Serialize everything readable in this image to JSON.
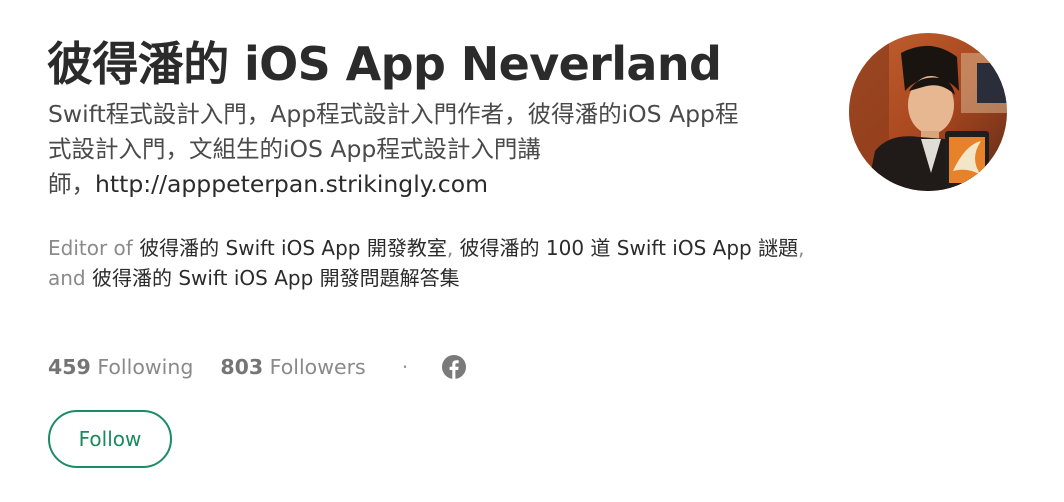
{
  "profile": {
    "name": "彼得潘的 iOS App Neverland",
    "bio_line1": "Swift程式設計入門，App程式設計入門作者，彼得潘的iOS App程",
    "bio_line2": "式設計入門，文組生的iOS App程式設計入門講",
    "bio_line3_prefix": "師，",
    "bio_url": "http://apppeterpan.strikingly.com"
  },
  "editor": {
    "prefix": "Editor of ",
    "publications": [
      "彼得潘的 Swift iOS App 開發教室",
      "彼得潘的 100 道 Swift iOS App 謎題",
      "彼得潘的 Swift iOS App 開發問題解答集"
    ],
    "separator": ", ",
    "and_word": "and "
  },
  "stats": {
    "following_count": "459",
    "following_label": "Following",
    "followers_count": "803",
    "followers_label": "Followers",
    "dot": "·",
    "social_icon": "facebook-icon"
  },
  "actions": {
    "follow_label": "Follow"
  },
  "colors": {
    "accent": "#1c8c64",
    "text_primary": "#2b2b2b",
    "text_secondary": "#8a8a8a"
  }
}
